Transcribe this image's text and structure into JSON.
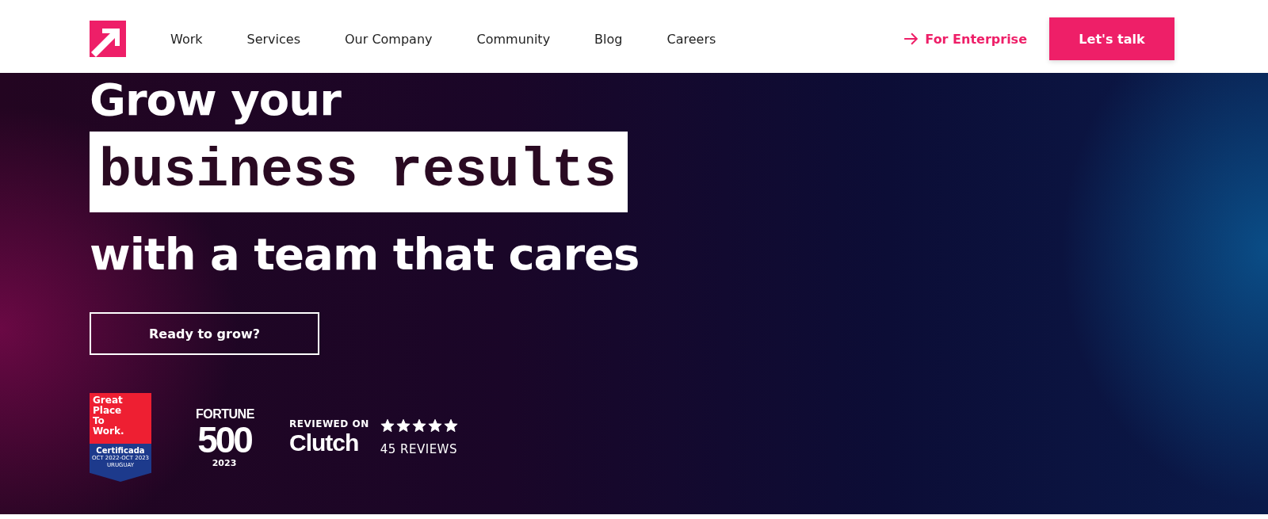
{
  "header": {
    "nav": [
      {
        "label": "Work"
      },
      {
        "label": "Services"
      },
      {
        "label": "Our Company"
      },
      {
        "label": "Community"
      },
      {
        "label": "Blog"
      },
      {
        "label": "Careers"
      }
    ],
    "enterprise_link": "For Enterprise",
    "cta": "Let's talk"
  },
  "hero": {
    "title_lines": [
      {
        "text": "Grow your",
        "kind": "plain"
      },
      {
        "text": "business results",
        "kind": "highlight"
      },
      {
        "text": "with a team that cares",
        "kind": "plain"
      }
    ],
    "button": "Ready to grow?",
    "badges": [
      {
        "kind": "gptw",
        "lines": [
          "Great",
          "Place",
          "To",
          "Work."
        ],
        "status": "Certificada",
        "period": "OCT 2022-OCT 2023",
        "country": "URUGUAY"
      },
      {
        "kind": "fortune",
        "top": "FORTUNE",
        "number": "500",
        "year": "2023"
      },
      {
        "kind": "clutch",
        "caption": "REVIEWED ON",
        "brand": "Clutch",
        "stars": 5,
        "reviews": "45 REVIEWS"
      }
    ]
  }
}
